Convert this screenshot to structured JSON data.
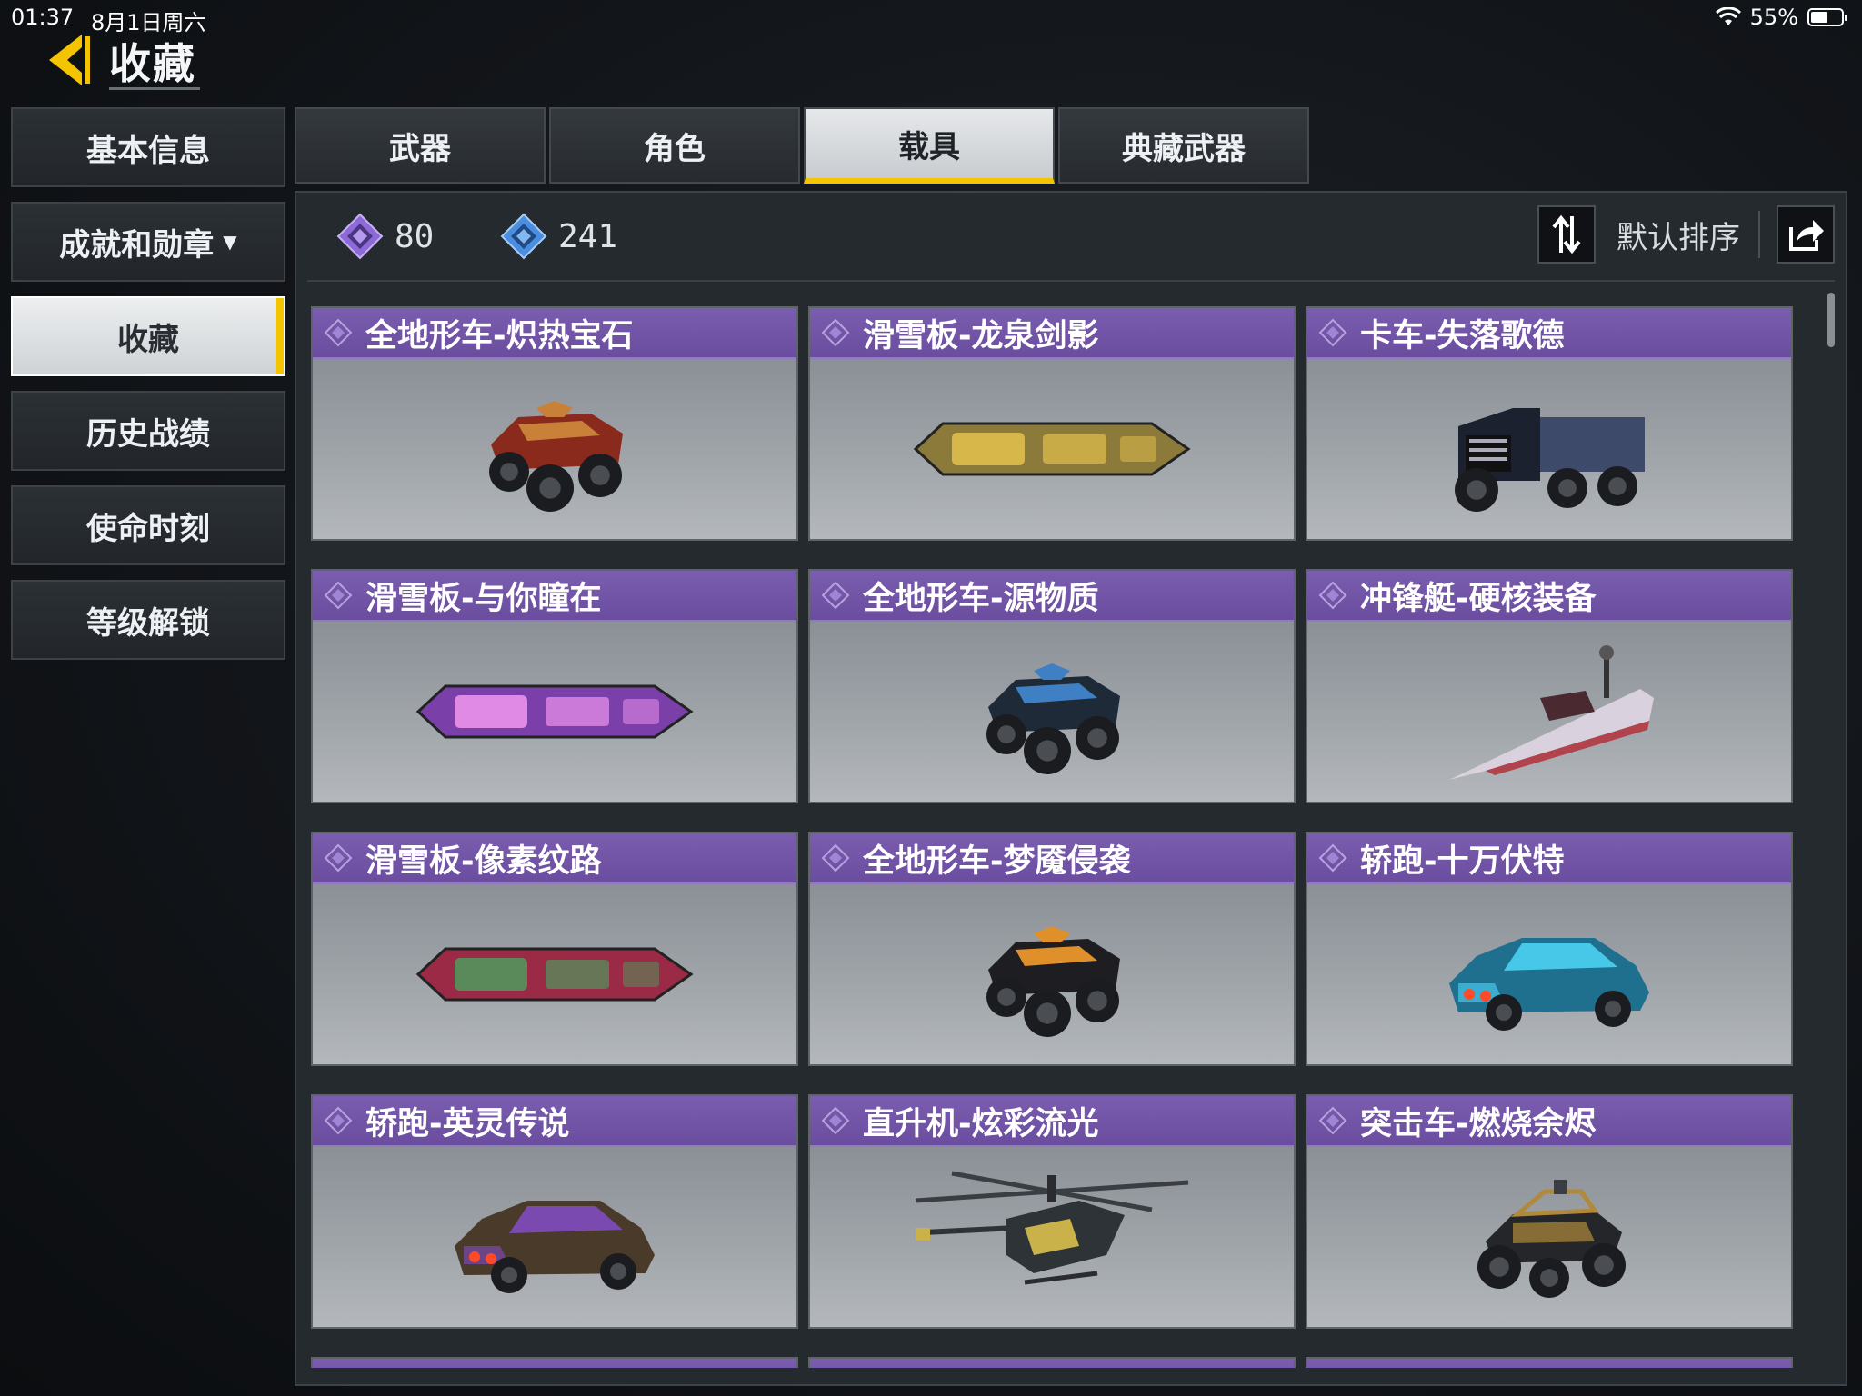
{
  "status_bar": {
    "time": "01:37",
    "date": "8月1日周六",
    "battery": "55%",
    "battery_level": 0.55
  },
  "header": {
    "title": "收藏"
  },
  "left_nav": {
    "items": [
      {
        "label": "基本信息"
      },
      {
        "label": "成就和勋章",
        "has_dropdown": true
      },
      {
        "label": "收藏",
        "active": true
      },
      {
        "label": "历史战绩"
      },
      {
        "label": "使命时刻"
      },
      {
        "label": "等级解锁"
      }
    ]
  },
  "tabs": [
    {
      "label": "武器"
    },
    {
      "label": "角色"
    },
    {
      "label": "载具",
      "active": true
    },
    {
      "label": "典藏武器"
    }
  ],
  "toolbar": {
    "currency_purple": "80",
    "currency_blue": "241",
    "sort_label": "默认排序"
  },
  "cards": [
    {
      "title": "全地形车-炽热宝石",
      "kind": "atv",
      "colors": [
        "#8a2a1c",
        "#c9813a"
      ]
    },
    {
      "title": "滑雪板-龙泉剑影",
      "kind": "board",
      "colors": [
        "#8c7a3a",
        "#d7b64a"
      ]
    },
    {
      "title": "卡车-失落歌德",
      "kind": "truck",
      "colors": [
        "#1c2130",
        "#3d4a6a"
      ]
    },
    {
      "title": "滑雪板-与你瞳在",
      "kind": "board",
      "colors": [
        "#7a3fa8",
        "#e08ae6"
      ]
    },
    {
      "title": "全地形车-源物质",
      "kind": "atv",
      "colors": [
        "#1e2a38",
        "#3f7fc4"
      ]
    },
    {
      "title": "冲锋艇-硬核装备",
      "kind": "boat",
      "colors": [
        "#d9d2de",
        "#b0434b"
      ]
    },
    {
      "title": "滑雪板-像素纹路",
      "kind": "board",
      "colors": [
        "#9a2a45",
        "#5a8a5a"
      ]
    },
    {
      "title": "全地形车-梦魇侵袭",
      "kind": "atv",
      "colors": [
        "#1d1d22",
        "#e0902a"
      ]
    },
    {
      "title": "轿跑-十万伏特",
      "kind": "car",
      "colors": [
        "#1f6f8f",
        "#48c8e8"
      ]
    },
    {
      "title": "轿跑-英灵传说",
      "kind": "car",
      "colors": [
        "#4a3a2a",
        "#7a4ab0"
      ]
    },
    {
      "title": "直升机-炫彩流光",
      "kind": "heli",
      "colors": [
        "#2e3338",
        "#c9b24a"
      ]
    },
    {
      "title": "突击车-燃烧余烬",
      "kind": "buggy",
      "colors": [
        "#24262a",
        "#b08a3a"
      ]
    }
  ],
  "colors": {
    "accent_yellow": "#f5c400",
    "card_header_purple": "#6a4d9e",
    "currency_purple": "#8e6ad8",
    "currency_blue": "#4a8ee0"
  },
  "icons": [
    "back-arrow-icon",
    "wifi-icon",
    "battery-icon",
    "purple-diamond-icon",
    "blue-diamond-icon",
    "sort-arrows-icon",
    "share-icon",
    "dropdown-caret-icon"
  ]
}
